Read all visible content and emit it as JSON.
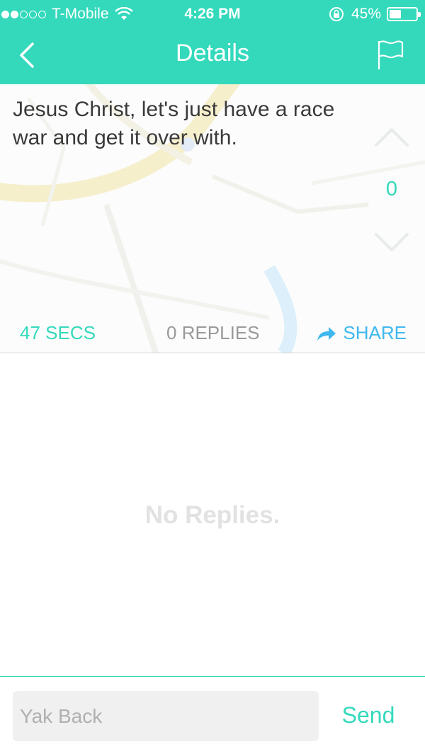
{
  "status_bar": {
    "carrier": "T-Mobile",
    "time": "4:26 PM",
    "battery_percent": "45%",
    "battery_level": 0.45,
    "signal_bars_filled": 2,
    "signal_bars_total": 5
  },
  "nav": {
    "title": "Details",
    "back_icon": "chevron-left-icon",
    "flag_icon": "flag-icon"
  },
  "post": {
    "text": "Jesus Christ, let's just have a race war and get it over with.",
    "vote_count": "0",
    "time_label": "47 SECS",
    "replies_label": "0 REPLIES",
    "share_label": "SHARE"
  },
  "replies": {
    "empty_message": "No Replies."
  },
  "composer": {
    "placeholder": "Yak Back",
    "value": "",
    "send_label": "Send"
  },
  "colors": {
    "accent": "#34d9bc",
    "share_blue": "#3fb8f0",
    "muted_text": "#9a9a9a"
  }
}
